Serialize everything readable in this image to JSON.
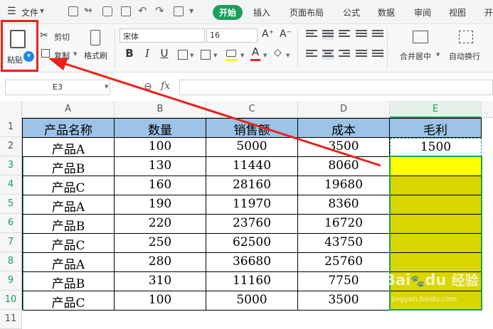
{
  "menu": {
    "file_label": "文件",
    "tabs": [
      "开始",
      "插入",
      "页面布局",
      "公式",
      "数据",
      "审阅",
      "视图",
      "开"
    ]
  },
  "ribbon": {
    "paste_label": "粘贴",
    "cut_label": "剪切",
    "copy_label": "复制",
    "format_painter_label": "格式刷",
    "font_name": "宋体",
    "font_size": "16",
    "bold": "B",
    "italic": "I",
    "underline": "U",
    "merge_label": "合并居中",
    "wrap_label": "自动换行",
    "increase_font": "A⁺",
    "decrease_font": "A⁻",
    "font_color_glyph": "A"
  },
  "formula_bar": {
    "name_box": "E3",
    "fx": "fx",
    "zoom_glyph": "⊖",
    "value": ""
  },
  "columns": [
    "A",
    "B",
    "C",
    "D",
    "E"
  ],
  "rows": [
    "1",
    "2",
    "3",
    "4",
    "5",
    "6",
    "7",
    "8",
    "9",
    "10",
    "11"
  ],
  "table": {
    "headers": [
      "产品名称",
      "数量",
      "销售额",
      "成本",
      "毛利"
    ],
    "data": [
      [
        "产品A",
        "100",
        "5000",
        "3500",
        "1500"
      ],
      [
        "产品B",
        "130",
        "11440",
        "8060",
        ""
      ],
      [
        "产品C",
        "160",
        "28160",
        "19680",
        ""
      ],
      [
        "产品A",
        "190",
        "11970",
        "8360",
        ""
      ],
      [
        "产品B",
        "220",
        "23760",
        "16720",
        ""
      ],
      [
        "产品C",
        "250",
        "62500",
        "43750",
        ""
      ],
      [
        "产品A",
        "280",
        "36680",
        "25760",
        ""
      ],
      [
        "产品B",
        "310",
        "11160",
        "7750",
        ""
      ],
      [
        "产品C",
        "100",
        "5000",
        "3500",
        ""
      ]
    ]
  },
  "watermark": {
    "brand": "Bai",
    "brand2": "du",
    "cn": "经验",
    "url": "jingyan.baidu.com"
  },
  "colors": {
    "accent": "#1aa05a",
    "header_fill": "#9dc3e6",
    "selection_fill": "#d9d600",
    "active_fill": "#ffff00",
    "annotation": "#e8231b"
  }
}
